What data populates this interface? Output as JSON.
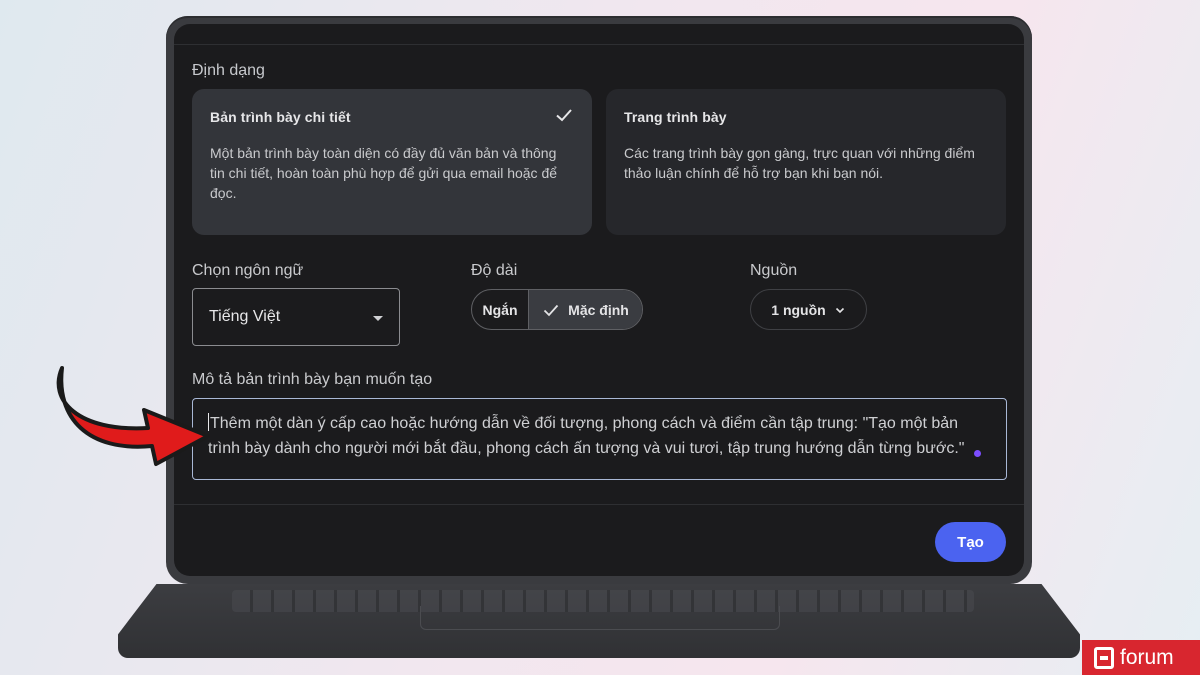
{
  "format": {
    "title": "Định dạng",
    "cards": [
      {
        "title": "Bản trình bày chi tiết",
        "desc": "Một bản trình bày toàn diện có đầy đủ văn bản và thông tin chi tiết, hoàn toàn phù hợp để gửi qua email hoặc để đọc.",
        "selected": true
      },
      {
        "title": "Trang trình bày",
        "desc": "Các trang trình bày gọn gàng, trực quan với những điểm thảo luận chính để hỗ trợ bạn khi bạn nói.",
        "selected": false
      }
    ]
  },
  "language": {
    "label": "Chọn ngôn ngữ",
    "value": "Tiếng Việt"
  },
  "length": {
    "label": "Độ dài",
    "options": [
      "Ngắn",
      "Mặc định"
    ],
    "selected": "Mặc định"
  },
  "sources": {
    "label": "Nguồn",
    "value": "1 nguồn"
  },
  "description": {
    "label": "Mô tả bản trình bày bạn muốn tạo",
    "placeholder": "Thêm một dàn ý cấp cao hoặc hướng dẫn về đối tượng, phong cách và điểm cần tập trung: \"Tạo một bản trình bày dành cho người mới bắt đầu, phong cách ấn tượng và vui tươi, tập trung hướng dẫn từng bước.\""
  },
  "actions": {
    "create_label": "Tạo"
  },
  "colors": {
    "accent": "#4b63f0",
    "arrow": "#e01b1b",
    "logo_bg": "#d8262f"
  },
  "logo": {
    "text": "forum"
  }
}
